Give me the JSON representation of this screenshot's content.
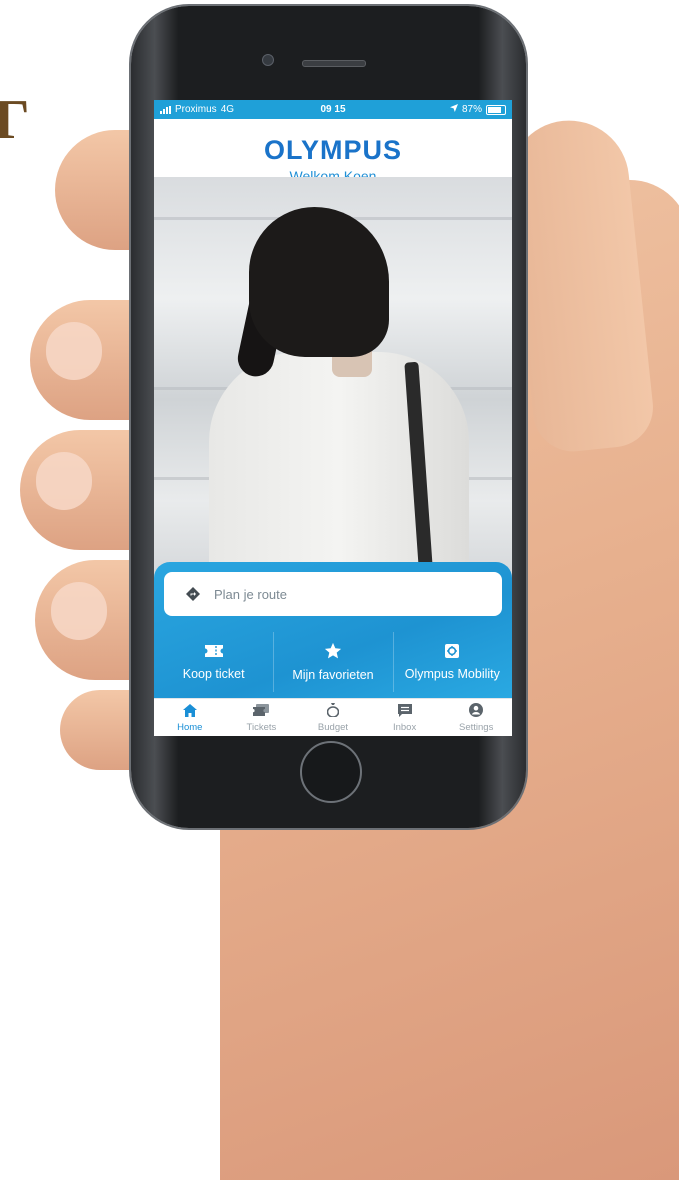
{
  "corner_glyph": "Г",
  "status_bar": {
    "carrier": "Proximus",
    "network": "4G",
    "time": "09 15",
    "battery": "87%"
  },
  "header": {
    "logo": "OLYMPUS",
    "welcome": "Welkom Koen"
  },
  "route": {
    "placeholder": "Plan je route"
  },
  "actions": [
    {
      "label": "Koop ticket",
      "icon": "ticket-icon"
    },
    {
      "label": "Mijn favorieten",
      "icon": "star-icon"
    },
    {
      "label": "Olympus Mobility",
      "icon": "mobility-icon"
    }
  ],
  "tabs": [
    {
      "label": "Home",
      "icon": "home-icon",
      "active": true
    },
    {
      "label": "Tickets",
      "icon": "tickets-icon",
      "active": false
    },
    {
      "label": "Budget",
      "icon": "budget-icon",
      "active": false
    },
    {
      "label": "Inbox",
      "icon": "inbox-icon",
      "active": false
    },
    {
      "label": "Settings",
      "icon": "settings-icon",
      "active": false
    }
  ],
  "colors": {
    "brand_blue": "#1fa0d8",
    "logo_blue": "#1a73c9",
    "active_tab": "#1a8fd6",
    "inactive_tab": "#9aa3aa"
  }
}
